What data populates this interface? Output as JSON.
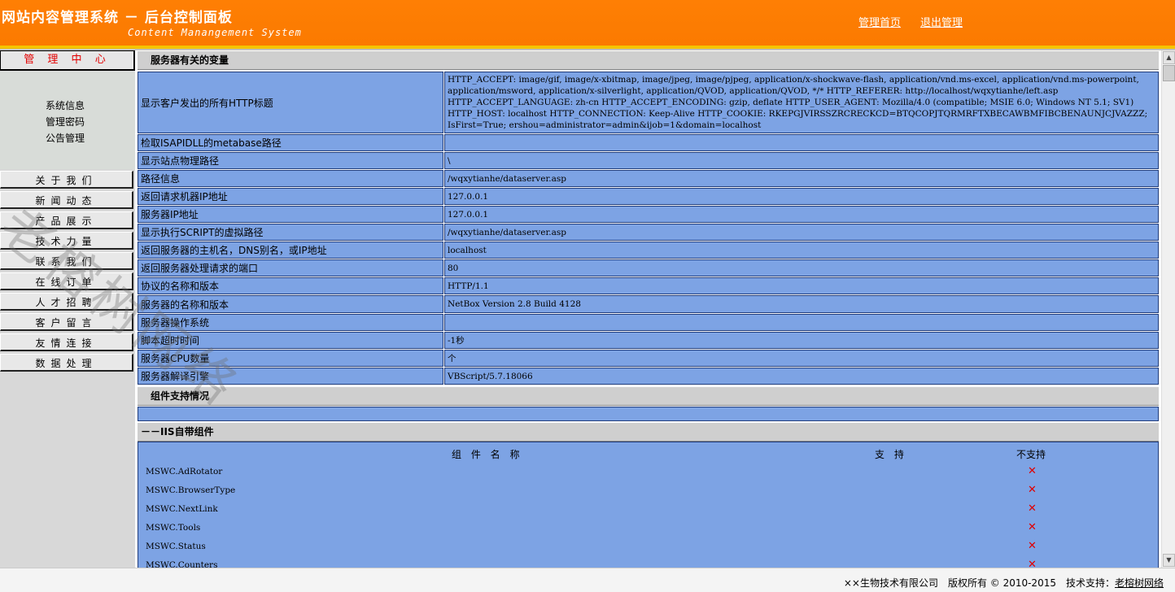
{
  "header": {
    "title": "网站内容管理系统 － 后台控制面板",
    "subtitle": "Content Manangement System",
    "links": [
      "管理首页",
      "退出管理"
    ]
  },
  "sidebar": {
    "heading": "管 理 中 心",
    "system_items": [
      "系统信息",
      "管理密码",
      "公告管理"
    ],
    "nav_items": [
      "关于我们",
      "新闻动态",
      "产品展示",
      "技术力量",
      "联系我们",
      "在线订单",
      "人才招聘",
      "客户留言",
      "友情连接",
      "数据处理"
    ]
  },
  "server_section": {
    "title": "服务器有关的变量",
    "rows": [
      {
        "label": "显示客户发出的所有HTTP标题",
        "value": "HTTP_ACCEPT: image/gif, image/x-xbitmap, image/jpeg, image/pjpeg, application/x-shockwave-flash, application/vnd.ms-excel, application/vnd.ms-powerpoint, application/msword, application/x-silverlight, application/QVOD, application/QVOD, */* HTTP_REFERER: http://localhost/wqxytianhe/left.asp HTTP_ACCEPT_LANGUAGE: zh-cn HTTP_ACCEPT_ENCODING: gzip, deflate HTTP_USER_AGENT: Mozilla/4.0 (compatible; MSIE 6.0; Windows NT 5.1; SV1) HTTP_HOST: localhost HTTP_CONNECTION: Keep-Alive HTTP_COOKIE: RKEPGJVIRSSZRCRECKCD=BTQCOPJTQRMRFTXBECAWBMFIBCBENAUNJCJVAZZZ; IsFirst=True; ershou=administrator=admin&ijob=1&domain=localhost"
      },
      {
        "label": "检取ISAPIDLL的metabase路径",
        "value": ""
      },
      {
        "label": "显示站点物理路径",
        "value": "\\"
      },
      {
        "label": "路径信息",
        "value": "/wqxytianhe/dataserver.asp"
      },
      {
        "label": "返回请求机器IP地址",
        "value": "127.0.0.1"
      },
      {
        "label": "服务器IP地址",
        "value": "127.0.0.1"
      },
      {
        "label": "显示执行SCRIPT的虚拟路径",
        "value": "/wqxytianhe/dataserver.asp"
      },
      {
        "label": "返回服务器的主机名，DNS别名，或IP地址",
        "value": "localhost"
      },
      {
        "label": "返回服务器处理请求的端口",
        "value": "80"
      },
      {
        "label": "协议的名称和版本",
        "value": "HTTP/1.1"
      },
      {
        "label": "服务器的名称和版本",
        "value": "NetBox Version 2.8 Build 4128"
      },
      {
        "label": "服务器操作系统",
        "value": ""
      },
      {
        "label": "脚本超时时间",
        "value": "-1秒"
      },
      {
        "label": "服务器CPU数量",
        "value": "个"
      },
      {
        "label": "服务器解译引擎",
        "value": "VBScript/5.7.18066"
      }
    ]
  },
  "component_section": {
    "title": "组件支持情况",
    "subtitle": "－－IIS自带组件",
    "headers": [
      "组 件 名 称",
      "支 持",
      "不支持"
    ],
    "components": [
      {
        "name": "MSWC.AdRotator",
        "status": "✕"
      },
      {
        "name": "MSWC.BrowserType",
        "status": "✕"
      },
      {
        "name": "MSWC.NextLink",
        "status": "✕"
      },
      {
        "name": "MSWC.Tools",
        "status": "✕"
      },
      {
        "name": "MSWC.Status",
        "status": "✕"
      },
      {
        "name": "MSWC.Counters",
        "status": "✕"
      }
    ]
  },
  "watermark": "老榕树网络",
  "footer": {
    "text": "××生物技术有限公司　版权所有 © 2010-2015　技术支持：",
    "link": "老榕树网络"
  }
}
